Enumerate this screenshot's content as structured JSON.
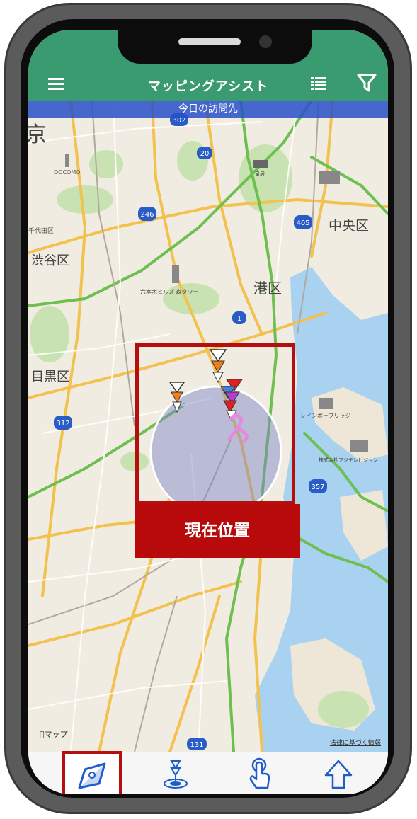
{
  "app": {
    "title": "マッピングアシスト"
  },
  "banner": {
    "text": "今日の訪問先"
  },
  "map": {
    "labels": {
      "kyo": "京",
      "shibuya": "渋谷区",
      "meguro": "目黒区",
      "minato": "港区",
      "chuo": "中央区",
      "docomo": "DOCOMO",
      "chiyoda": "千代田区",
      "roppongi": "六本木ヒルズ 森タワー",
      "rainbow": "レインボーブリッジ",
      "fuji": "株式会社フジテレビジョン",
      "kokyo": "皇居"
    },
    "route_shields": [
      "302",
      "20",
      "246",
      "405",
      "1",
      "312",
      "357",
      "131"
    ],
    "credit": "マップ",
    "legal": "法律に基づく情報"
  },
  "current_location": {
    "label": "現在位置"
  },
  "bottom_tabs": [
    {
      "id": "compass",
      "active": true
    },
    {
      "id": "target",
      "active": false
    },
    {
      "id": "touch",
      "active": false
    },
    {
      "id": "navigate",
      "active": false
    }
  ],
  "colors": {
    "appbar": "#3a9b70",
    "banner": "#2850c8",
    "highlight": "#b50e0e",
    "map_land": "#f1ece1",
    "map_water": "#a8d0f0",
    "map_park": "#c8e2b0"
  }
}
